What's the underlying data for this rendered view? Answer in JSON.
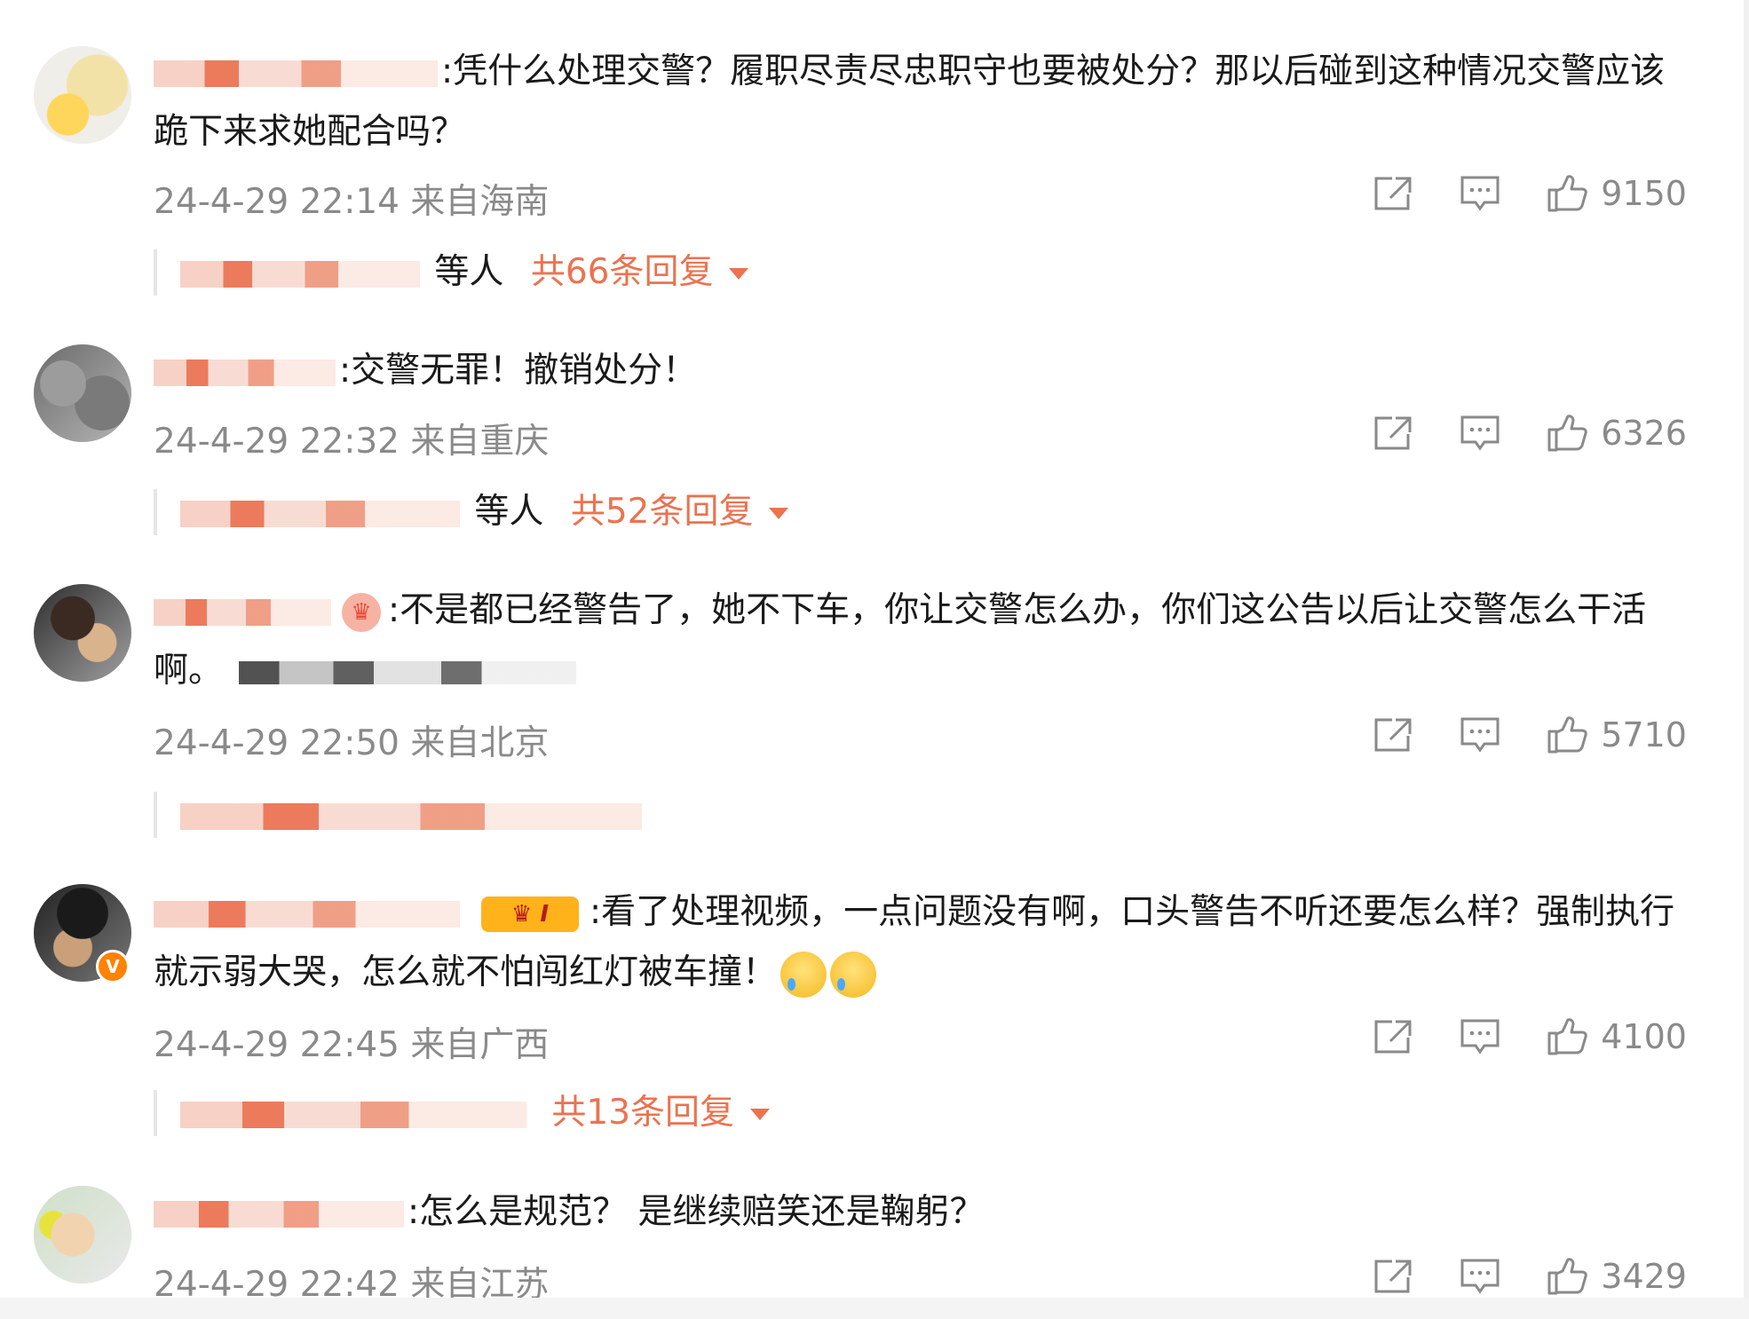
{
  "comments": [
    {
      "username": "小胡……",
      "text": ":凭什么处理交警？履职尽责尽忠职守也要被处分？那以后碰到这种情况交警应该跪下来求她配合吗？",
      "time": "24-4-29 22:14",
      "location": "来自海南",
      "likes": "9150",
      "reply_user": "赛博……",
      "reply_suffix": "等人",
      "reply_count": "共66条回复"
    },
    {
      "username": "海……ms",
      "text": ":交警无罪！撤销处分！",
      "time": "24-4-29 22:32",
      "location": "来自重庆",
      "likes": "6326",
      "reply_user": "用户77……",
      "reply_suffix": "等人",
      "reply_count": "共52条回复"
    },
    {
      "username": "莆……火",
      "text": ":不是都已经警告了，她不下车，你让交警怎么办，你们这公告以后让交警怎么干活啊。",
      "time": "24-4-29 22:50",
      "location": "来自北京",
      "likes": "5710"
    },
    {
      "username": "追……momo酱",
      "text": ":看了处理视频，一点问题没有啊，口头警告不听还要怎么样？强制执行就示弱大哭，怎么就不怕闯红灯被车撞！",
      "time": "24-4-29 22:45",
      "location": "来自广西",
      "likes": "4100",
      "reply_count": "共13条回复",
      "vip_label": "I"
    },
    {
      "username": "……",
      "text": ":怎么是规范？ 是继续赔笑还是鞠躬？",
      "time": "24-4-29 22:42",
      "location": "来自江苏",
      "likes": "3429"
    }
  ],
  "icons": {
    "share": "share-icon",
    "comment": "comment-icon",
    "like": "thumbs-up-icon"
  },
  "colors": {
    "username": "#eb7350",
    "meta": "#8a8a8a",
    "vip_badge": "#ff8200"
  }
}
